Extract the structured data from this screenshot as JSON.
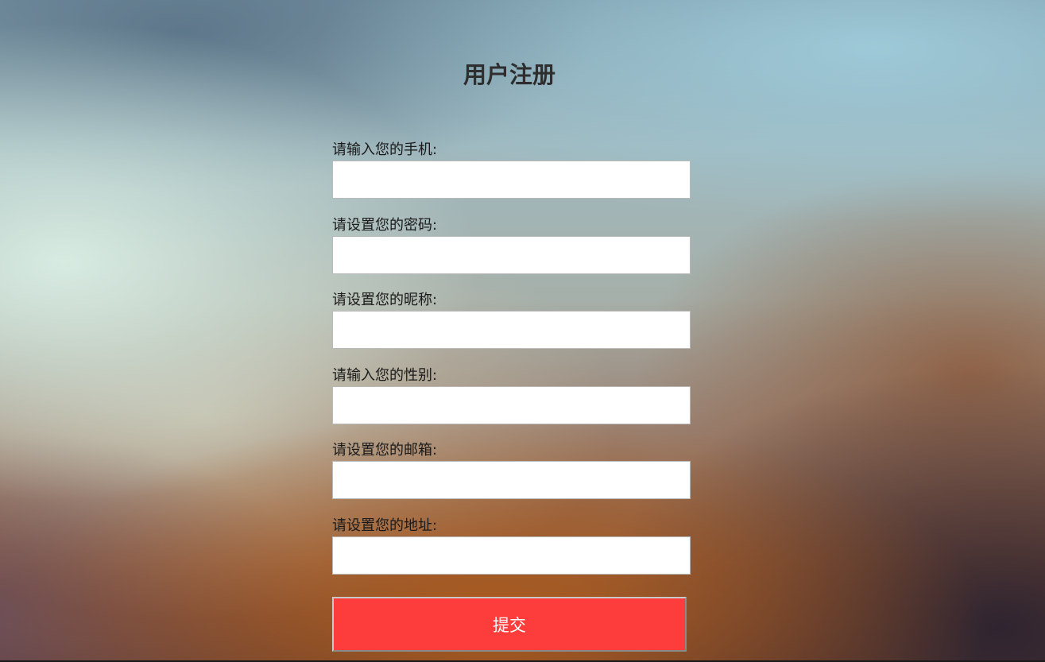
{
  "page": {
    "title": "用户注册"
  },
  "form": {
    "fields": [
      {
        "label": "请输入您的手机:",
        "value": "",
        "placeholder": ""
      },
      {
        "label": "请设置您的密码:",
        "value": "",
        "placeholder": ""
      },
      {
        "label": "请设置您的昵称:",
        "value": "",
        "placeholder": ""
      },
      {
        "label": "请输入您的性别:",
        "value": "",
        "placeholder": ""
      },
      {
        "label": "请设置您的邮箱:",
        "value": "",
        "placeholder": ""
      },
      {
        "label": "请设置您的地址:",
        "value": "",
        "placeholder": ""
      }
    ],
    "submit_label": "提交"
  },
  "colors": {
    "submit_background": "#fd3c3c",
    "title_text": "#2e2e2e",
    "input_background": "#ffffff"
  }
}
